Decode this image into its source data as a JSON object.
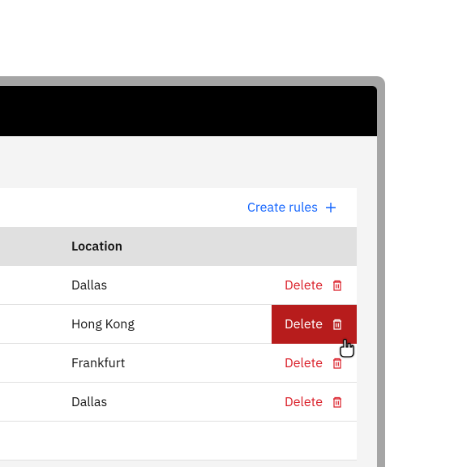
{
  "toolbar": {
    "create_rules_label": "Create rules"
  },
  "table": {
    "header": "Location",
    "rows": [
      {
        "location": "Dallas",
        "action": "Delete"
      },
      {
        "location": "Hong Kong",
        "action": "Delete"
      },
      {
        "location": "Frankfurt",
        "action": "Delete"
      },
      {
        "location": "Dallas",
        "action": "Delete"
      }
    ]
  },
  "colors": {
    "primary": "#0f62fe",
    "danger": "#da1e28",
    "danger_hover": "#b71c1c"
  }
}
